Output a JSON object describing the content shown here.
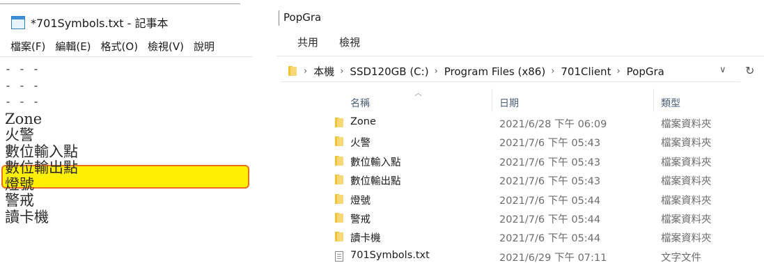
{
  "notepad": {
    "title": "*701Symbols.txt - 記事本",
    "menu": [
      "檔案(F)",
      "編輯(E)",
      "格式(O)",
      "檢視(V)",
      "說明"
    ],
    "lines": [
      "- - -",
      "- - -",
      "- - -",
      "Zone",
      "火警",
      "數位輸入點",
      "數位輸出點",
      "燈號",
      "警戒",
      "讀卡機"
    ],
    "highlighted_line": "燈號",
    "highlight_color": "#ffef00",
    "highlight_border_color": "#ec6f20"
  },
  "explorer": {
    "title": "PopGra",
    "tabs": [
      "共用",
      "檢視"
    ],
    "breadcrumb": [
      "本機",
      "SSD120GB (C:)",
      "Program Files (x86)",
      "701Client",
      "PopGra"
    ],
    "columns": {
      "name": "名稱",
      "date": "日期",
      "type": "類型"
    },
    "files": [
      {
        "name": "Zone",
        "date": "2021/6/28 下午 06:09",
        "type": "檔案資料夾",
        "icon": "folder-icon"
      },
      {
        "name": "火警",
        "date": "2021/7/6 下午 05:43",
        "type": "檔案資料夾",
        "icon": "folder-icon"
      },
      {
        "name": "數位輸入點",
        "date": "2021/7/6 下午 05:43",
        "type": "檔案資料夾",
        "icon": "folder-icon"
      },
      {
        "name": "數位輸出點",
        "date": "2021/7/6 下午 05:43",
        "type": "檔案資料夾",
        "icon": "folder-icon"
      },
      {
        "name": "燈號",
        "date": "2021/7/6 下午 05:44",
        "type": "檔案資料夾",
        "icon": "folder-icon"
      },
      {
        "name": "警戒",
        "date": "2021/7/6 下午 05:44",
        "type": "檔案資料夾",
        "icon": "folder-icon"
      },
      {
        "name": "讀卡機",
        "date": "2021/7/6 下午 05:44",
        "type": "檔案資料夾",
        "icon": "folder-icon"
      },
      {
        "name": "701Symbols.txt",
        "date": "2021/6/29 下午 07:11",
        "type": "文字文件",
        "icon": "text-file-icon"
      }
    ]
  }
}
